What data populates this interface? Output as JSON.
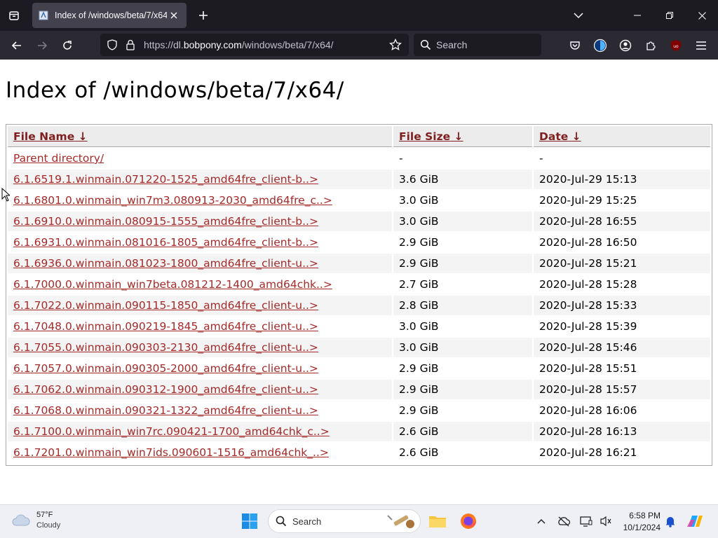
{
  "browser": {
    "tab": {
      "title": "Index of /windows/beta/7/x64/"
    },
    "url": {
      "scheme": "https://dl.",
      "host": "bobpony.com",
      "path": "/windows/beta/7/x64/"
    },
    "search": {
      "placeholder": "Search"
    }
  },
  "page": {
    "heading": "Index of /windows/beta/7/x64/",
    "columns": [
      {
        "label": "File Name",
        "sort": "↓"
      },
      {
        "label": "File Size",
        "sort": "↓"
      },
      {
        "label": "Date",
        "sort": "↓"
      }
    ],
    "rows": [
      {
        "name": "Parent directory/",
        "size": "-",
        "date": "-"
      },
      {
        "name": "6.1.6519.1.winmain.071220-1525_amd64fre_client-b..>",
        "size": "3.6 GiB",
        "date": "2020-Jul-29 15:13"
      },
      {
        "name": "6.1.6801.0.winmain_win7m3.080913-2030_amd64fre_c..>",
        "size": "3.0 GiB",
        "date": "2020-Jul-29 15:25"
      },
      {
        "name": "6.1.6910.0.winmain.080915-1555_amd64fre_client-b..>",
        "size": "3.0 GiB",
        "date": "2020-Jul-28 16:55"
      },
      {
        "name": "6.1.6931.0.winmain.081016-1805_amd64fre_client-b..>",
        "size": "2.9 GiB",
        "date": "2020-Jul-28 16:50"
      },
      {
        "name": "6.1.6936.0.winmain.081023-1800_amd64fre_client-u..>",
        "size": "2.9 GiB",
        "date": "2020-Jul-28 15:21"
      },
      {
        "name": "6.1.7000.0.winmain_win7beta.081212-1400_amd64chk..>",
        "size": "2.7 GiB",
        "date": "2020-Jul-28 15:28"
      },
      {
        "name": "6.1.7022.0.winmain.090115-1850_amd64fre_client-u..>",
        "size": "2.8 GiB",
        "date": "2020-Jul-28 15:33"
      },
      {
        "name": "6.1.7048.0.winmain.090219-1845_amd64fre_client-u..>",
        "size": "3.0 GiB",
        "date": "2020-Jul-28 15:39"
      },
      {
        "name": "6.1.7055.0.winmain.090303-2130_amd64fre_client-u..>",
        "size": "3.0 GiB",
        "date": "2020-Jul-28 15:46"
      },
      {
        "name": "6.1.7057.0.winmain.090305-2000_amd64fre_client-u..>",
        "size": "2.9 GiB",
        "date": "2020-Jul-28 15:51"
      },
      {
        "name": "6.1.7062.0.winmain.090312-1900_amd64fre_client-u..>",
        "size": "2.9 GiB",
        "date": "2020-Jul-28 15:57"
      },
      {
        "name": "6.1.7068.0.winmain.090321-1322_amd64fre_client-u..>",
        "size": "2.9 GiB",
        "date": "2020-Jul-28 16:06"
      },
      {
        "name": "6.1.7100.0.winmain_win7rc.090421-1700_amd64chk_c..>",
        "size": "2.6 GiB",
        "date": "2020-Jul-28 16:13"
      },
      {
        "name": "6.1.7201.0.winmain_win7ids.090601-1516_amd64chk_..>",
        "size": "2.6 GiB",
        "date": "2020-Jul-28 16:21"
      }
    ]
  },
  "taskbar": {
    "weather": {
      "temp": "57°F",
      "condition": "Cloudy"
    },
    "search": {
      "placeholder": "Search"
    },
    "clock": {
      "time": "6:58 PM",
      "date": "10/1/2024"
    }
  },
  "colors": {
    "link": "#a52a2a",
    "header_link": "#7f1f1f",
    "browser_dark": "#1c1b22",
    "toolbar": "#2b2a33"
  }
}
